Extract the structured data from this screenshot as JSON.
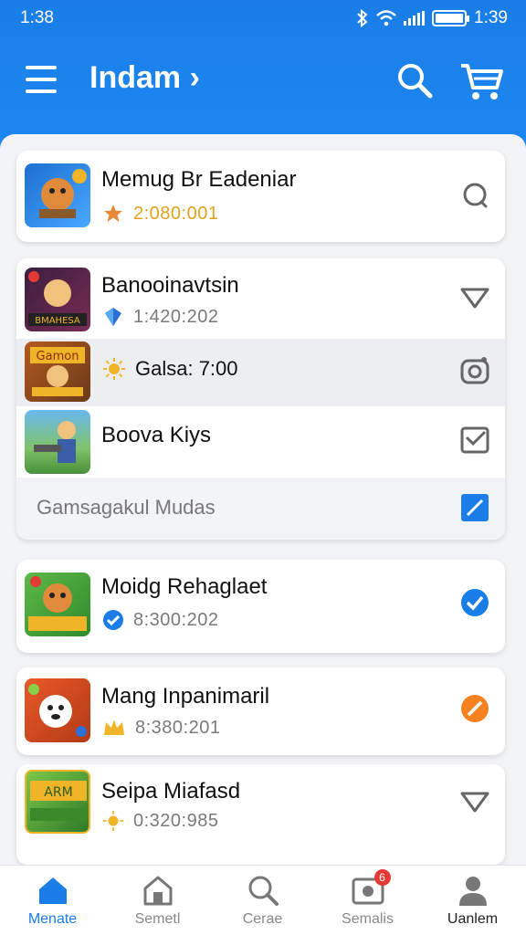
{
  "status_bar": {
    "time_left": "1:38",
    "time_right": "1:39"
  },
  "app_bar": {
    "title": "Indam ›"
  },
  "cards": [
    {
      "title": "Memug Br Eadeniar",
      "meta": "2:080:001",
      "meta_color": "#e0a21a",
      "meta_icon": "star-icon",
      "trail_icon": "chat-icon"
    },
    {
      "title": "Banooinavtsin",
      "meta": "1:420:202",
      "meta_icon": "gem-icon",
      "trail_icon": "triangle-down-icon"
    },
    {
      "title": "Galsa: 7:00",
      "meta_icon": "sun-icon",
      "trail_icon": "camera-icon",
      "highlighted": true
    },
    {
      "title": "Boova Kiys",
      "trail_icon": "checkbox-icon"
    },
    {
      "title": "Gamsagakul Mudas",
      "trail_icon": "edit-square-icon",
      "footer": true
    },
    {
      "title": "Moidg Rehaglaet",
      "meta": "8:300:202",
      "meta_icon": "verified-icon",
      "trail_icon": "check-circle-icon",
      "trail_color": "#1a7de8"
    },
    {
      "title": "Mang Inpanimaril",
      "meta": "8:380:201",
      "meta_icon": "crown-icon",
      "trail_icon": "edit-circle-icon",
      "trail_color": "#f5821f"
    },
    {
      "title": "Seipa Miafasd",
      "meta": "0:320:985",
      "meta_icon": "sun-icon",
      "trail_icon": "triangle-down-icon"
    }
  ],
  "tabs": [
    {
      "label": "Menate",
      "icon": "home-icon",
      "active": true
    },
    {
      "label": "Semetl",
      "icon": "shop-icon"
    },
    {
      "label": "Cerae",
      "icon": "search-icon"
    },
    {
      "label": "Semalis",
      "icon": "mail-icon",
      "badge": "6"
    },
    {
      "label": "Uanlem",
      "icon": "profile-icon"
    }
  ],
  "colors": {
    "primary": "#1a7de8",
    "orange": "#f5821f",
    "badge": "#e53935"
  }
}
